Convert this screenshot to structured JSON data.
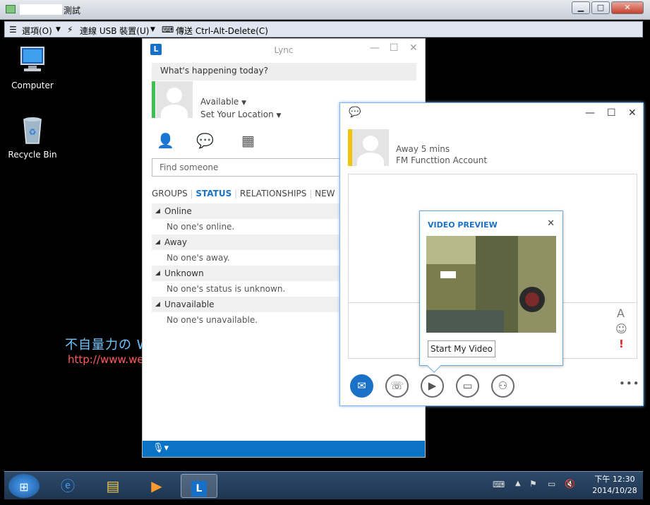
{
  "window": {
    "title": "測試"
  },
  "toolbar": {
    "options": "選項(O)",
    "usb": "連線 USB 裝置(U)",
    "cad": "傳送 Ctrl-Alt-Delete(C)"
  },
  "desktop": {
    "icons": [
      {
        "label": "Computer"
      },
      {
        "label": "Recycle Bin"
      }
    ]
  },
  "watermark": {
    "line1": "不自量力の Weithenn",
    "line2": "http://www.weithenn.org"
  },
  "lync": {
    "title": "Lync",
    "status_message": "What's happening today?",
    "availability": "Available",
    "location": "Set Your Location",
    "search_placeholder": "Find someone",
    "tabs": [
      "GROUPS",
      "STATUS",
      "RELATIONSHIPS",
      "NEW"
    ],
    "groups": [
      {
        "name": "Online",
        "empty": "No one's online."
      },
      {
        "name": "Away",
        "empty": "No one's away."
      },
      {
        "name": "Unknown",
        "empty": "No one's status is unknown."
      },
      {
        "name": "Unavailable",
        "empty": "No one's unavailable."
      }
    ]
  },
  "conversation": {
    "contact_status": "Away 5 mins",
    "contact_name": "FM Functtion Account"
  },
  "video_preview": {
    "title": "VIDEO PREVIEW",
    "start_button": "Start My Video"
  },
  "taskbar": {
    "time": "下午 12:30",
    "date": "2014/10/28"
  },
  "colors": {
    "accent": "#0a73c3",
    "available": "#3fbf4f",
    "away": "#f2c400"
  }
}
